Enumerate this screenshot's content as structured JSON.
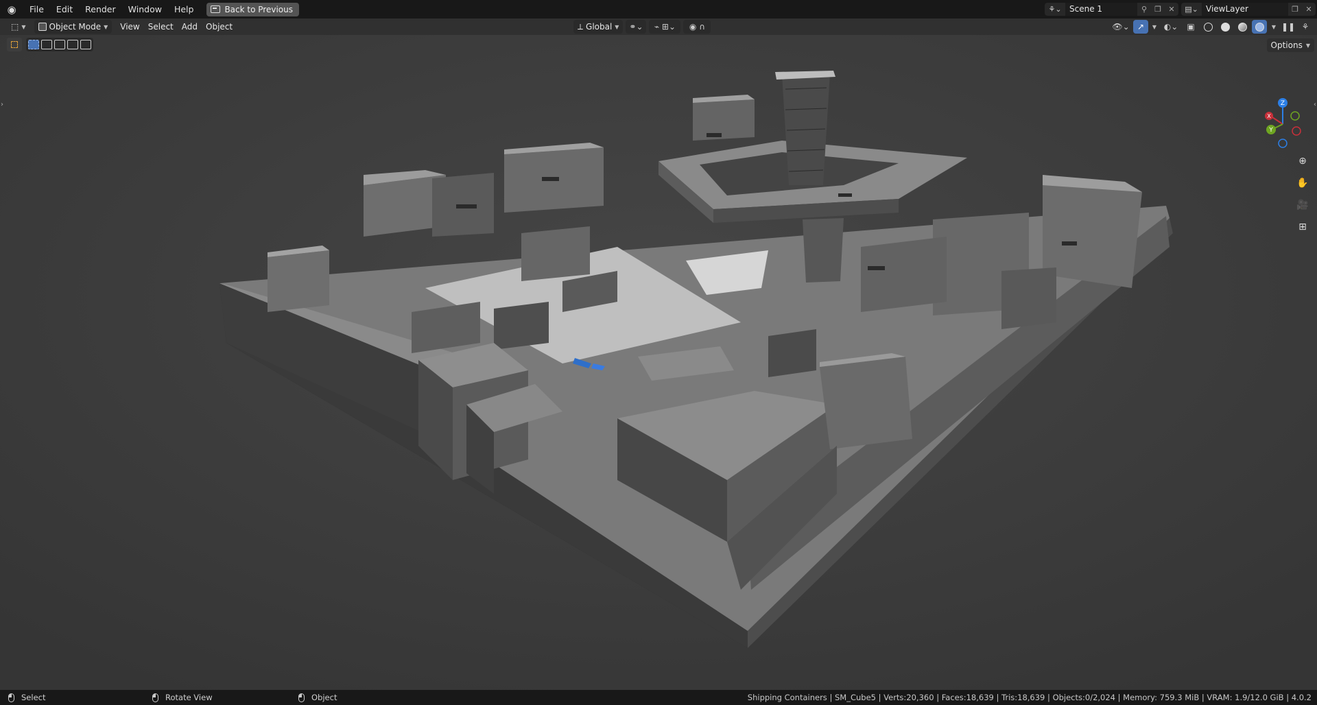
{
  "topbar": {
    "menus": [
      "File",
      "Edit",
      "Render",
      "Window",
      "Help"
    ],
    "back_button": "Back to Previous",
    "scene_name": "Scene 1",
    "view_layer": "ViewLayer"
  },
  "header": {
    "mode": "Object Mode",
    "menus": [
      "View",
      "Select",
      "Add",
      "Object"
    ],
    "orientation": "Global",
    "options": "Options"
  },
  "gizmo": {
    "z": "Z",
    "x": "X",
    "y": "Y",
    "x_color": "#c8303a",
    "y_color": "#6ea521",
    "z_color": "#2c7fe6"
  },
  "status": {
    "select": "Select",
    "rotate": "Rotate View",
    "object": "Object",
    "stats": "Shipping Containers | SM_Cube5 | Verts:20,360 | Faces:18,639 | Tris:18,639 | Objects:0/2,024 | Memory: 759.3 MiB | VRAM: 1.9/12.0 GiB | 4.0.2"
  },
  "colors": {
    "accent": "#4772b3",
    "viewport_bg": "#3c3c3c"
  }
}
